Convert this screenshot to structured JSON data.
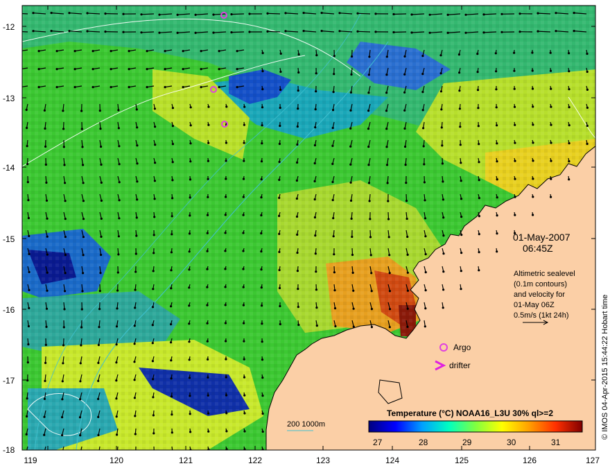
{
  "map": {
    "date_label": "01-May-2007",
    "time_label": "06:45Z",
    "info_lines": [
      "Altimetric sealevel",
      "(0.1m contours)",
      "and velocity for",
      "01-May 06Z",
      "0.5m/s (1kt 24h)"
    ],
    "legend_argo": "Argo",
    "legend_drifter": "drifter",
    "depth_label": "200  1000m",
    "colorbar_title": "Temperature (°C) NOAA16_L3U 30% ql>=2",
    "colorbar_ticks": [
      "27",
      "28",
      "29",
      "30",
      "31"
    ],
    "credit": "© IMOS 04-Apr-2015 15:44:22 Hobart time",
    "x_ticks": [
      "119",
      "120",
      "121",
      "122",
      "123",
      "124",
      "125",
      "126",
      "127"
    ],
    "y_ticks": [
      "-12",
      "-13",
      "-14",
      "-15",
      "-16",
      "-17",
      "-18"
    ],
    "colors": {
      "land": "#fbcfa6",
      "argo": "#e040e0",
      "drifter": "#e020e0",
      "depth_contour": "#40c0d0",
      "colorbar_stops": [
        "#00007f",
        "#0000ff",
        "#00a0ff",
        "#00ffc0",
        "#80ff40",
        "#ffff00",
        "#ffa000",
        "#ff3000",
        "#800000"
      ]
    }
  }
}
